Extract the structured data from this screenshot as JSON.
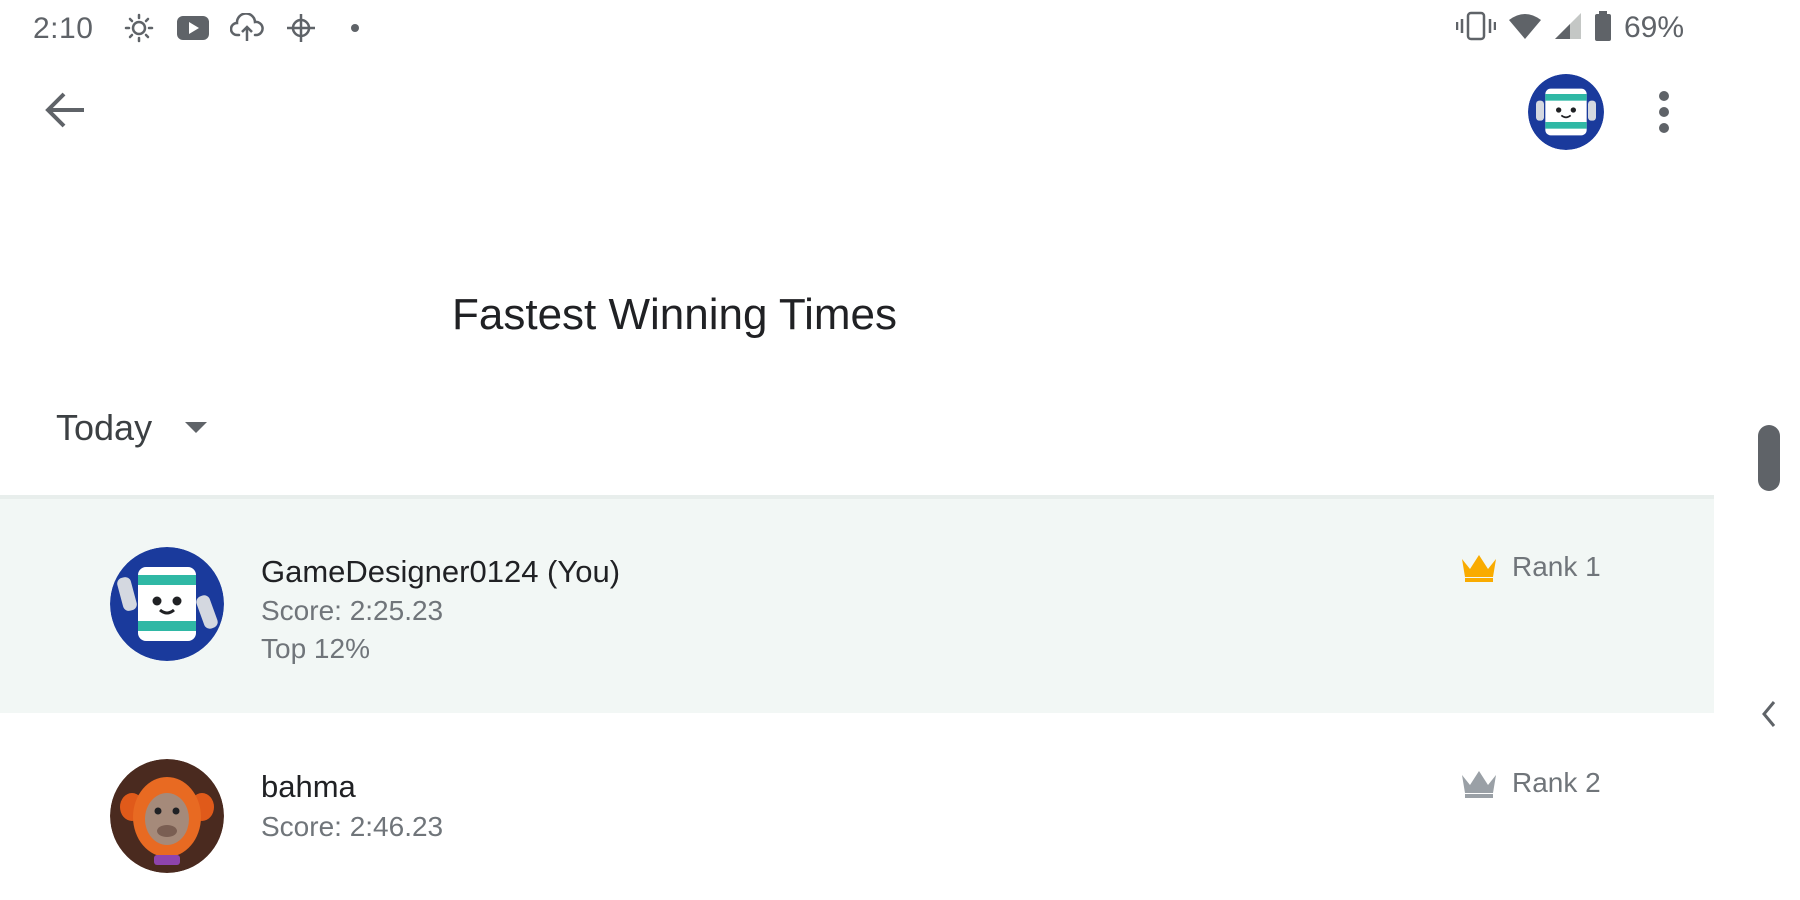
{
  "status_bar": {
    "time": "2:10",
    "battery_percent": "69%",
    "left_icons": [
      "brightness-icon",
      "youtube-icon",
      "cloud-upload-icon",
      "crosshair-icon",
      "dot-icon"
    ],
    "right_icons": [
      "vibrate-icon",
      "wifi-icon",
      "cell-signal-icon",
      "battery-icon"
    ]
  },
  "app_bar": {
    "back_icon": "arrow-back-icon",
    "avatar": "player-avatar-robot",
    "more_icon": "more-vert-icon"
  },
  "page": {
    "title": "Fastest Winning Times"
  },
  "filter": {
    "selected": "Today",
    "icon": "dropdown-triangle-icon"
  },
  "leaderboard": [
    {
      "name": "GameDesigner0124 (You)",
      "score": "Score: 2:25.23",
      "percentile": "Top 12%",
      "rank": "Rank 1",
      "crown_color": "#f9ab00",
      "highlighted": true,
      "avatar": "robot-avatar"
    },
    {
      "name": "bahma",
      "score": "Score: 2:46.23",
      "rank": "Rank 2",
      "crown_color": "#9aa0a6",
      "highlighted": false,
      "avatar": "monkey-avatar"
    }
  ],
  "colors": {
    "highlight_row": "#f2f7f5",
    "gold_crown": "#f9ab00",
    "silver_crown": "#9aa0a6",
    "robot_avatar_bg": "#1a3a9c",
    "robot_accent": "#2fb8a5"
  }
}
